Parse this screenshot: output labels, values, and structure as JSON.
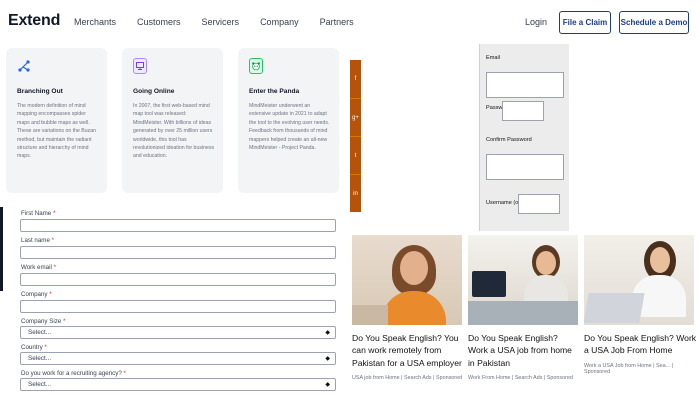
{
  "brand": {
    "logo_text": "Extend"
  },
  "nav": {
    "links": [
      "Merchants",
      "Customers",
      "Servicers",
      "Company",
      "Partners"
    ],
    "login": "Login",
    "file_claim": "File a Claim",
    "schedule_demo": "Schedule a Demo"
  },
  "cards": [
    {
      "icon": "share-nodes-icon",
      "title": "Branching Out",
      "body": "The modern definition of mind mapping encompasses spider maps and bubble maps as well. These are variations on the Buzan method, but maintain the radiant structure and hierarchy of mind maps."
    },
    {
      "icon": "monitor-icon",
      "title": "Going Online",
      "body": "In 2007, the first web-based mind map tool was released: MindMeister. With billions of ideas generated by over 25 million users worldwide, this tool has revolutionized ideation for business and education."
    },
    {
      "icon": "panda-icon",
      "title": "Enter the Panda",
      "body": "MindMeister underwent an extensive update in 2021 to adapt the tool to the evolving user needs. Feedback from thousands of mind mappers helped create an all-new MindMeister - Project Panda."
    }
  ],
  "social": [
    "f",
    "g+",
    "t",
    "in"
  ],
  "register": {
    "email": "Email",
    "password": "Password",
    "confirm_password": "Confirm Password",
    "username": "Username (optional)"
  },
  "form": {
    "first_name": "First Name",
    "last_name": "Last name",
    "work_email": "Work email",
    "company": "Company",
    "company_size": "Company Size",
    "company_size_value": "Select...",
    "country": "Country",
    "country_value": "Select...",
    "agency": "Do you work for a recruiting agency?",
    "agency_value": "Select...",
    "required_mark": "*"
  },
  "ads": [
    {
      "title": "Do You Speak English? You can work remotely from Pakistan for a USA employer",
      "source": "USA job from Home | Search Ads | Sponsored"
    },
    {
      "title": "Do You Speak English? Work a USA job from home in Pakistan",
      "source": "Work From Home | Search Ads | Sponsored"
    },
    {
      "title": "Do You Speak English? Work a USA Job From Home",
      "source": "Work a USA Job from Home | Sea... | Sponsored"
    }
  ],
  "colors": {
    "brand_navy": "#1e3a8a",
    "social_bar": "#b45309",
    "required": "#dc2626"
  }
}
